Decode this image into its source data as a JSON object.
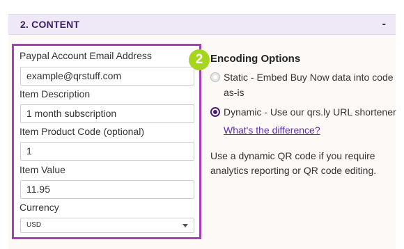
{
  "section": {
    "title": "2. CONTENT",
    "toggle": "-"
  },
  "step_badge": "2",
  "form": {
    "email": {
      "label": "Paypal Account Email Address",
      "value": "example@qrstuff.com"
    },
    "description": {
      "label": "Item Description",
      "value": "1 month subscription"
    },
    "product_code": {
      "label": "Item Product Code (optional)",
      "value": "1"
    },
    "value": {
      "label": "Item Value",
      "value": "11.95"
    },
    "currency": {
      "label": "Currency",
      "selected": "USD"
    }
  },
  "encoding": {
    "title": "Encoding Options",
    "static_line1": "Static - Embed Buy Now data into code",
    "static_line2": "as-is",
    "dynamic_label": "Dynamic - Use our qrs.ly URL shortener",
    "difference_link": "What's the difference?",
    "info_line1": "Use a dynamic QR code if you require",
    "info_line2": "analytics reporting or QR code editing."
  },
  "colors": {
    "accent": "#a43fb5",
    "header_bg": "#efe8f6",
    "badge": "#a6d51f",
    "radio_selected": "#4a1a7a",
    "link": "#5a2bb0"
  }
}
